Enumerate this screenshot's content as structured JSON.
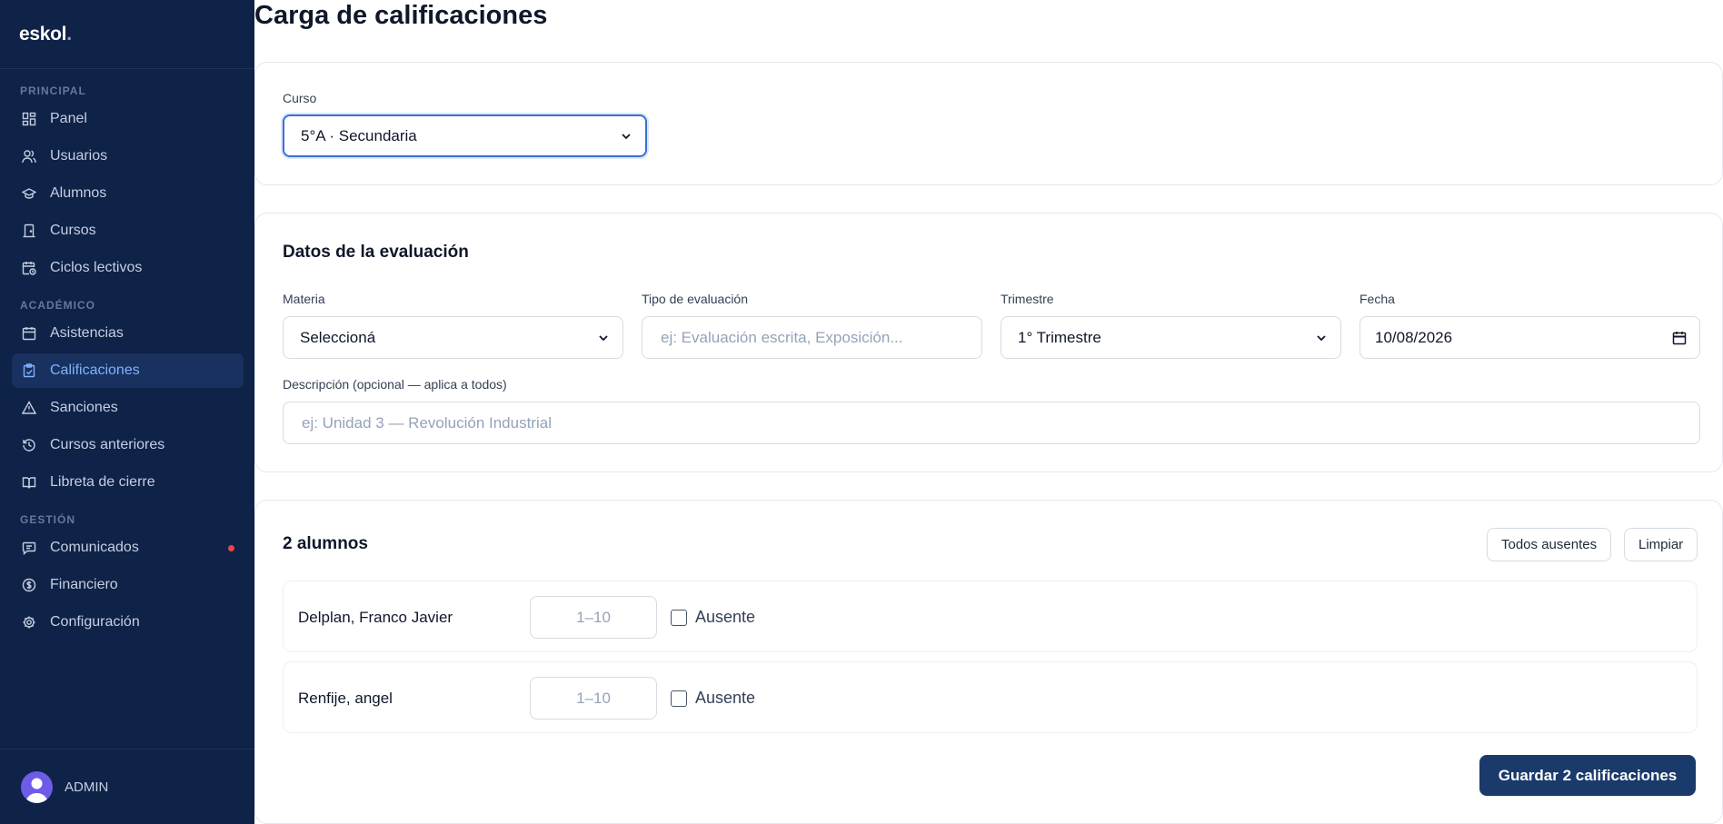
{
  "brand": {
    "name": "eskol",
    "dot": "."
  },
  "sidebar": {
    "sections": [
      {
        "label": "PRINCIPAL",
        "items": [
          {
            "label": "Panel",
            "icon": "grid-icon"
          },
          {
            "label": "Usuarios",
            "icon": "users-icon"
          },
          {
            "label": "Alumnos",
            "icon": "graduation-cap-icon"
          },
          {
            "label": "Cursos",
            "icon": "door-icon"
          },
          {
            "label": "Ciclos lectivos",
            "icon": "calendar-clock-icon"
          }
        ]
      },
      {
        "label": "ACADÉMICO",
        "items": [
          {
            "label": "Asistencias",
            "icon": "calendar-icon"
          },
          {
            "label": "Calificaciones",
            "icon": "clipboard-check-icon",
            "active": true
          },
          {
            "label": "Sanciones",
            "icon": "warning-icon"
          },
          {
            "label": "Cursos anteriores",
            "icon": "history-icon"
          },
          {
            "label": "Libreta de cierre",
            "icon": "book-icon"
          }
        ]
      },
      {
        "label": "GESTIÓN",
        "items": [
          {
            "label": "Comunicados",
            "icon": "message-icon",
            "badge": true
          },
          {
            "label": "Financiero",
            "icon": "dollar-icon"
          },
          {
            "label": "Configuración",
            "icon": "gear-icon"
          }
        ]
      }
    ],
    "user": {
      "name": "ADMIN"
    }
  },
  "page": {
    "title": "Carga de calificaciones"
  },
  "curso": {
    "label": "Curso",
    "value": "5°A · Secundaria"
  },
  "evaluacion": {
    "title": "Datos de la evaluación",
    "materia": {
      "label": "Materia",
      "value": "Seleccioná"
    },
    "tipo": {
      "label": "Tipo de evaluación",
      "placeholder": "ej: Evaluación escrita, Exposición..."
    },
    "trimestre": {
      "label": "Trimestre",
      "value": "1° Trimestre"
    },
    "fecha": {
      "label": "Fecha",
      "value": "10/08/2026"
    },
    "descripcion": {
      "label": "Descripción (opcional — aplica a todos)",
      "placeholder": "ej: Unidad 3 — Revolución Industrial"
    }
  },
  "alumnos": {
    "title": "2 alumnos",
    "todos_ausentes": "Todos ausentes",
    "limpiar": "Limpiar",
    "grade_placeholder": "1–10",
    "absent_label": "Ausente",
    "rows": [
      {
        "name": "Delplan, Franco Javier"
      },
      {
        "name": "Renfije, angel"
      }
    ],
    "save_label": "Guardar 2 calificaciones"
  },
  "colors": {
    "sidebar_bg": "#0f2247",
    "active_bg": "#18315f",
    "active_text": "#7fb3ff",
    "primary_button": "#1a3a6b",
    "badge": "#ef4444"
  }
}
